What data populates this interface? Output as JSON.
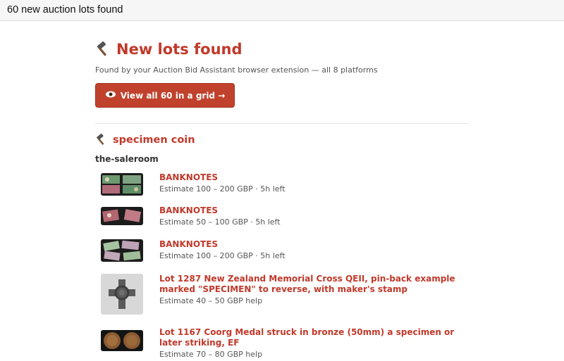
{
  "window": {
    "title": "60 new auction lots found"
  },
  "header": {
    "title": "New lots found",
    "icon": "hammer-icon",
    "subtitle": "Found by your Auction Bid Assistant browser extension — all 8 platforms",
    "button_label": "View all 60 in a grid →",
    "button_icon": "eye-icon"
  },
  "search": {
    "query": "specimen coin",
    "platform": "the-saleroom",
    "lots": [
      {
        "title": "BANKNOTES",
        "meta": "Estimate 100 – 200 GBP · 5h left",
        "thumb": "banknotes-image"
      },
      {
        "title": "BANKNOTES",
        "meta": "Estimate 50 – 100 GBP · 5h left",
        "thumb": "banknotes-image"
      },
      {
        "title": "BANKNOTES",
        "meta": "Estimate 100 – 200 GBP · 5h left",
        "thumb": "banknotes-image"
      },
      {
        "title": "Lot 1287 New Zealand Memorial Cross QEII, pin-back example marked \"SPECIMEN\" to reverse, with maker's stamp",
        "meta": "Estimate 40 – 50 GBP help",
        "thumb": "memorial-cross-image"
      },
      {
        "title": "Lot 1167 Coorg Medal struck in bronze (50mm) a specimen or later striking, EF",
        "meta": "Estimate 70 – 80 GBP help",
        "thumb": "bronze-medal-image"
      }
    ]
  },
  "colors": {
    "accent": "#c0392b",
    "button": "#c0422d"
  }
}
